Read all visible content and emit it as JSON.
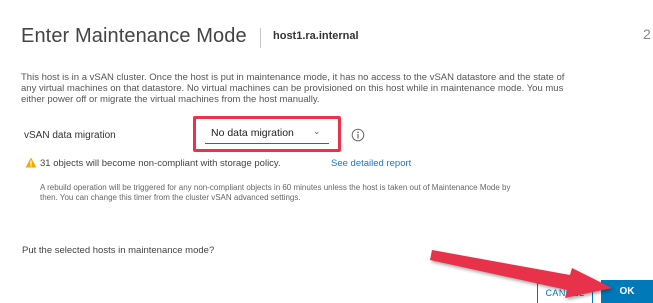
{
  "dialog": {
    "title": "Enter Maintenance Mode",
    "host": "host1.ra.internal",
    "close_glyph": "2"
  },
  "description_lines": [
    "This host is in a vSAN cluster. Once the host is put in maintenance mode, it has no access to the vSAN datastore and the state of",
    "any virtual machines on that datastore. No virtual machines can be provisioned on this host while in maintenance mode. You mus",
    "either power off or migrate the virtual machines from the host manually."
  ],
  "migration": {
    "label": "vSAN data migration",
    "selected": "No data migration",
    "chevron_icon": "chevron-down-icon",
    "info_icon": "info-icon"
  },
  "warning": {
    "icon": "warning-icon",
    "text": "31 objects will become non-compliant with storage policy.",
    "link": "See detailed report",
    "color": "#e8a000"
  },
  "rebuild_lines": [
    "A rebuild operation will be triggered for any non-compliant objects in 60 minutes unless the host is taken out of Maintenance Mode by",
    "then. You can change this timer from the cluster vSAN advanced settings."
  ],
  "question": "Put the selected hosts in maintenance mode?",
  "buttons": {
    "cancel": "CANCEL",
    "ok": "OK"
  },
  "colors": {
    "accent": "#0079b8",
    "highlight_box": "#e8334a",
    "annotation_arrow": "#e8334a"
  }
}
